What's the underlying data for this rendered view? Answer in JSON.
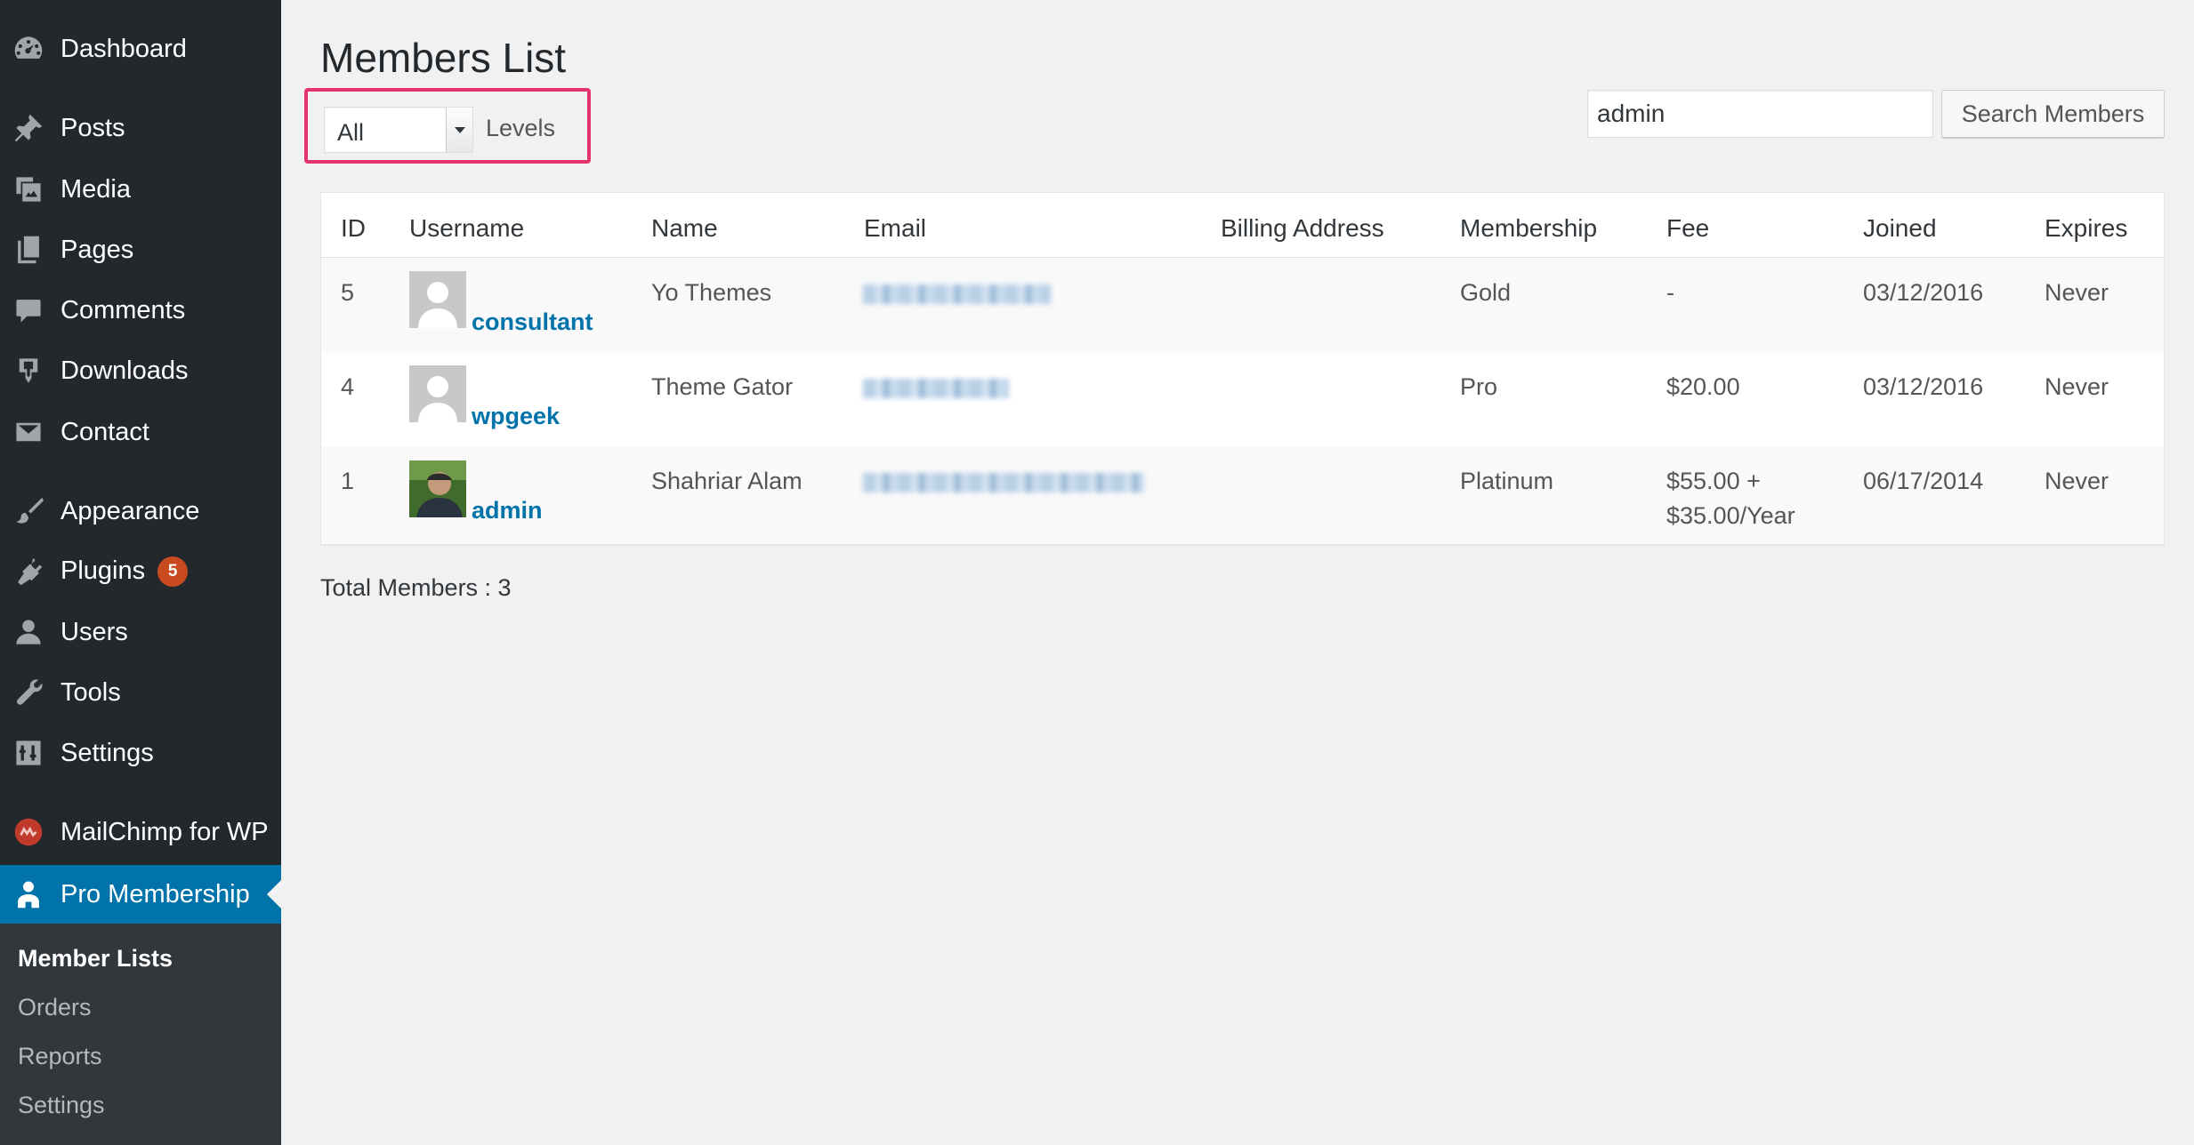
{
  "sidebar": {
    "items": [
      {
        "label": "Dashboard",
        "icon": "dashboard-icon"
      },
      {
        "label": "Posts",
        "icon": "pin-icon"
      },
      {
        "label": "Media",
        "icon": "media-icon"
      },
      {
        "label": "Pages",
        "icon": "pages-icon"
      },
      {
        "label": "Comments",
        "icon": "comment-icon"
      },
      {
        "label": "Downloads",
        "icon": "download-icon"
      },
      {
        "label": "Contact",
        "icon": "envelope-icon"
      },
      {
        "label": "Appearance",
        "icon": "brush-icon"
      },
      {
        "label": "Plugins",
        "icon": "plug-icon",
        "badge": "5"
      },
      {
        "label": "Users",
        "icon": "user-icon"
      },
      {
        "label": "Tools",
        "icon": "wrench-icon"
      },
      {
        "label": "Settings",
        "icon": "sliders-icon"
      },
      {
        "label": "MailChimp for WP",
        "icon": "mailchimp-icon"
      },
      {
        "label": "Pro Membership",
        "icon": "membership-icon"
      }
    ],
    "submenu": [
      "Member Lists",
      "Orders",
      "Reports",
      "Settings"
    ]
  },
  "page": {
    "title": "Members List",
    "level_filter": {
      "selected": "All",
      "label": "Levels"
    },
    "search": {
      "value": "admin",
      "button": "Search Members"
    }
  },
  "table": {
    "headers": [
      "ID",
      "Username",
      "Name",
      "Email",
      "Billing Address",
      "Membership",
      "Fee",
      "Joined",
      "Expires"
    ],
    "rows": [
      {
        "id": "5",
        "username": "consultant",
        "name": "Yo Themes",
        "email": "",
        "billing": "",
        "membership": "Gold",
        "fee": "-",
        "fee2": "",
        "joined": "03/12/2016",
        "expires": "Never"
      },
      {
        "id": "4",
        "username": "wpgeek",
        "name": "Theme Gator",
        "email": "",
        "billing": "",
        "membership": "Pro",
        "fee": "$20.00",
        "fee2": "",
        "joined": "03/12/2016",
        "expires": "Never"
      },
      {
        "id": "1",
        "username": "admin",
        "name": "Shahriar Alam",
        "email": "",
        "billing": "",
        "membership": "Platinum",
        "fee": "$55.00 +",
        "fee2": "$35.00/Year",
        "joined": "06/17/2014",
        "expires": "Never"
      }
    ]
  },
  "total_members": "Total Members : 3",
  "colors": {
    "sidebar": "#23282d",
    "submenu": "#32373c",
    "accent": "#0073aa",
    "highlight": "#e5336b",
    "badge": "#ca4a1f"
  }
}
